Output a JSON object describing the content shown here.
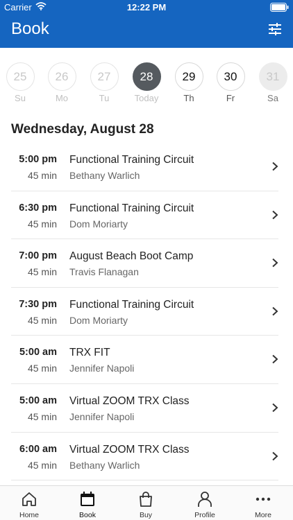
{
  "status_bar": {
    "carrier": "Carrier",
    "time": "12:22 PM"
  },
  "header": {
    "title": "Book",
    "filter_icon": "sliders-icon",
    "background": "#1565c0"
  },
  "week": [
    {
      "num": "25",
      "label": "Su",
      "state": "past"
    },
    {
      "num": "26",
      "label": "Mo",
      "state": "past"
    },
    {
      "num": "27",
      "label": "Tu",
      "state": "past"
    },
    {
      "num": "28",
      "label": "Today",
      "state": "selected"
    },
    {
      "num": "29",
      "label": "Th",
      "state": "future"
    },
    {
      "num": "30",
      "label": "Fr",
      "state": "future"
    },
    {
      "num": "31",
      "label": "Sa",
      "state": "disabled"
    }
  ],
  "date_heading": "Wednesday, August 28",
  "classes": [
    {
      "time": "5:00 pm",
      "duration": "45 min",
      "name": "Functional Training Circuit",
      "instructor": "Bethany Warlich"
    },
    {
      "time": "6:30 pm",
      "duration": "45 min",
      "name": "Functional Training Circuit",
      "instructor": "Dom Moriarty"
    },
    {
      "time": "7:00 pm",
      "duration": "45 min",
      "name": "August Beach Boot Camp",
      "instructor": "Travis Flanagan"
    },
    {
      "time": "7:30 pm",
      "duration": "45 min",
      "name": "Functional Training Circuit",
      "instructor": "Dom Moriarty"
    },
    {
      "time": "5:00 am",
      "duration": "45 min",
      "name": "TRX FIT",
      "instructor": "Jennifer Napoli"
    },
    {
      "time": "5:00 am",
      "duration": "45 min",
      "name": "Virtual ZOOM TRX Class",
      "instructor": "Jennifer Napoli"
    },
    {
      "time": "6:00 am",
      "duration": "45 min",
      "name": "Virtual ZOOM TRX Class",
      "instructor": "Bethany Warlich"
    }
  ],
  "tabs": [
    {
      "label": "Home",
      "icon": "home-icon"
    },
    {
      "label": "Book",
      "icon": "calendar-icon",
      "active": true
    },
    {
      "label": "Buy",
      "icon": "shopping-bag-icon"
    },
    {
      "label": "Profile",
      "icon": "person-icon"
    },
    {
      "label": "More",
      "icon": "more-dots-icon"
    }
  ]
}
